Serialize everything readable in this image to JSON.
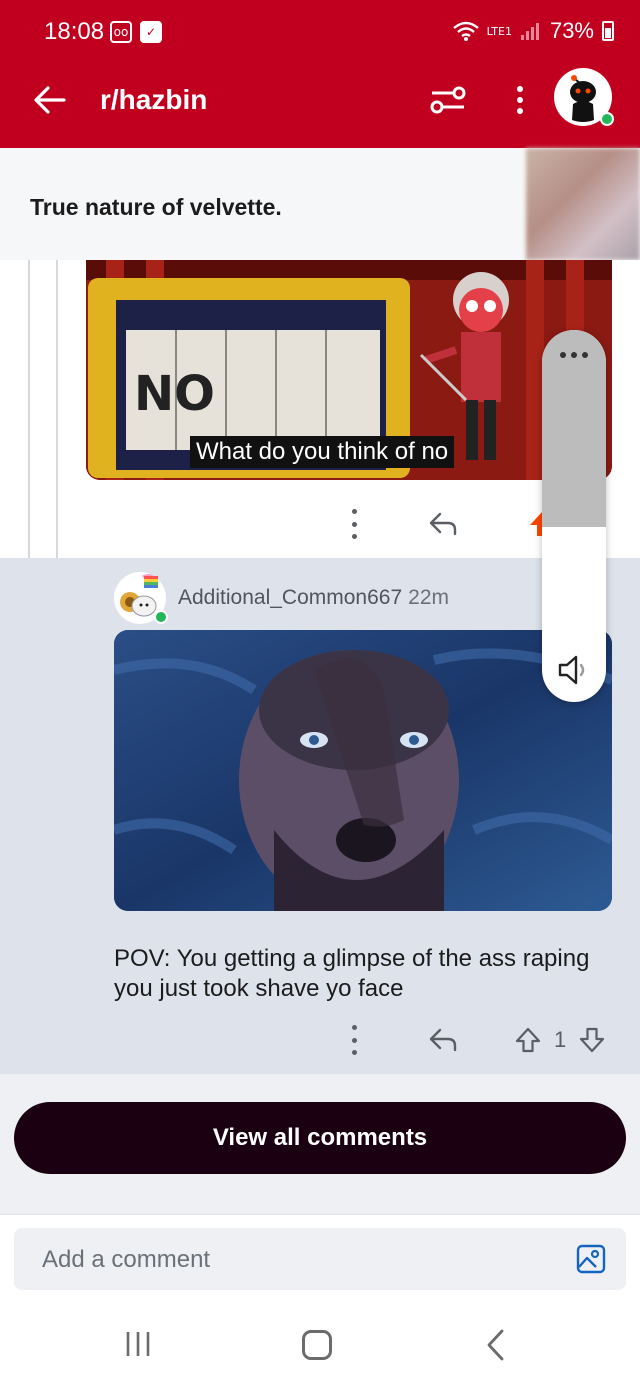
{
  "status_bar": {
    "time": "18:08",
    "battery": "73%",
    "network": "LTE1"
  },
  "app_bar": {
    "title": "r/hazbin"
  },
  "post": {
    "title": "True nature of velvette."
  },
  "comments": [
    {
      "image_caption": "What do you think of no",
      "vote_count": ""
    },
    {
      "author": "Additional_Common667",
      "time": "22m",
      "text": "POV: You getting a glimpse of the ass raping you just took shave yo face",
      "vote_count": "1"
    }
  ],
  "view_all": {
    "label": "View all comments"
  },
  "composer": {
    "placeholder": "Add a comment"
  },
  "colors": {
    "brand_red": "#c1001f",
    "upvote_orange": "#ff4500",
    "button_dark": "#1a0011"
  },
  "volume_panel": {
    "level": 0.47
  }
}
